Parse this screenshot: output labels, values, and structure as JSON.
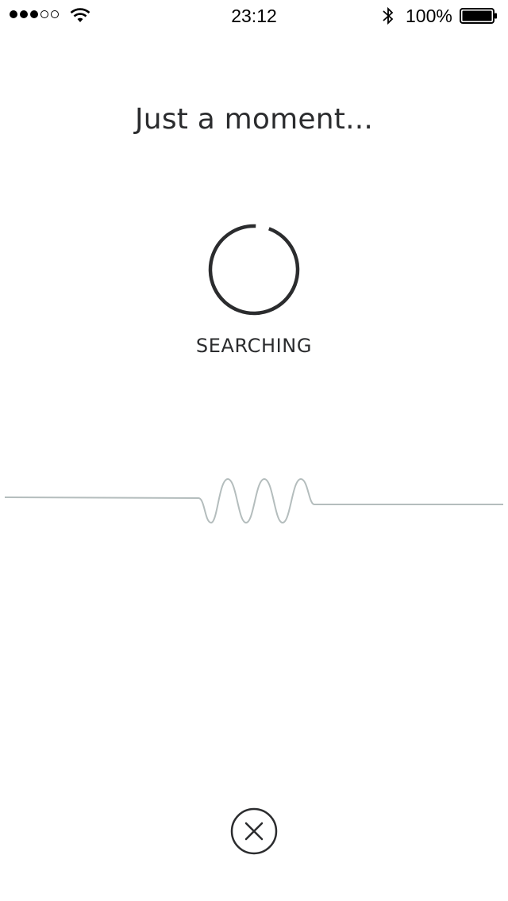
{
  "status_bar": {
    "signal_filled": 3,
    "signal_total": 5,
    "time": "23:12",
    "battery_percent": "100%",
    "icons": [
      "signal-dots-icon",
      "wifi-icon",
      "bluetooth-icon",
      "battery-icon"
    ]
  },
  "screen": {
    "title": "Just a moment...",
    "status": "SEARCHING",
    "progress_fraction": 0.95
  },
  "actions": {
    "cancel_icon": "close-circle-icon"
  },
  "colors": {
    "text": "#2b2c2e",
    "spinner": "#2b2c2e",
    "waveform": "#b4bdbd",
    "background": "#ffffff"
  }
}
